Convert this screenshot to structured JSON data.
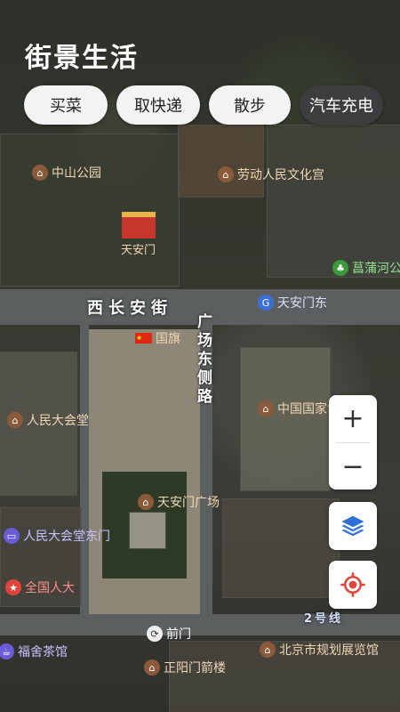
{
  "app": {
    "title": "街景生活"
  },
  "chips": [
    {
      "label": "买菜"
    },
    {
      "label": "取快递"
    },
    {
      "label": "散步"
    },
    {
      "label": "汽车充电"
    }
  ],
  "map": {
    "pois": [
      {
        "label": "中山公园",
        "icon": "landmark-icon"
      },
      {
        "label": "劳动人民文化宫",
        "icon": "landmark-icon"
      },
      {
        "label": "天安门",
        "icon": "gate-icon"
      },
      {
        "label": "菖蒲河公园",
        "icon": "park-icon"
      },
      {
        "label": "天安门东",
        "icon": "metro-icon"
      },
      {
        "label": "国旗",
        "icon": "flag-icon"
      },
      {
        "label": "人民大会堂",
        "icon": "landmark-icon"
      },
      {
        "label": "中国国家博物馆",
        "icon": "landmark-icon"
      },
      {
        "label": "天安门广场",
        "icon": "landmark-icon"
      },
      {
        "label": "人民大会堂东门",
        "icon": "venue-icon"
      },
      {
        "label": "全国人大",
        "icon": "star-icon"
      },
      {
        "label": "前门",
        "icon": "metro-icon"
      },
      {
        "label": "北京市规划展览馆",
        "icon": "landmark-icon"
      },
      {
        "label": "正阳门箭楼",
        "icon": "landmark-icon"
      },
      {
        "label": "福舍茶馆",
        "icon": "teahouse-icon"
      }
    ],
    "streets": [
      {
        "label": "西长安街"
      },
      {
        "label": "广场东侧路"
      },
      {
        "label": "2号线"
      }
    ]
  },
  "controls": {
    "zoom_in": "+",
    "zoom_out": "−"
  }
}
